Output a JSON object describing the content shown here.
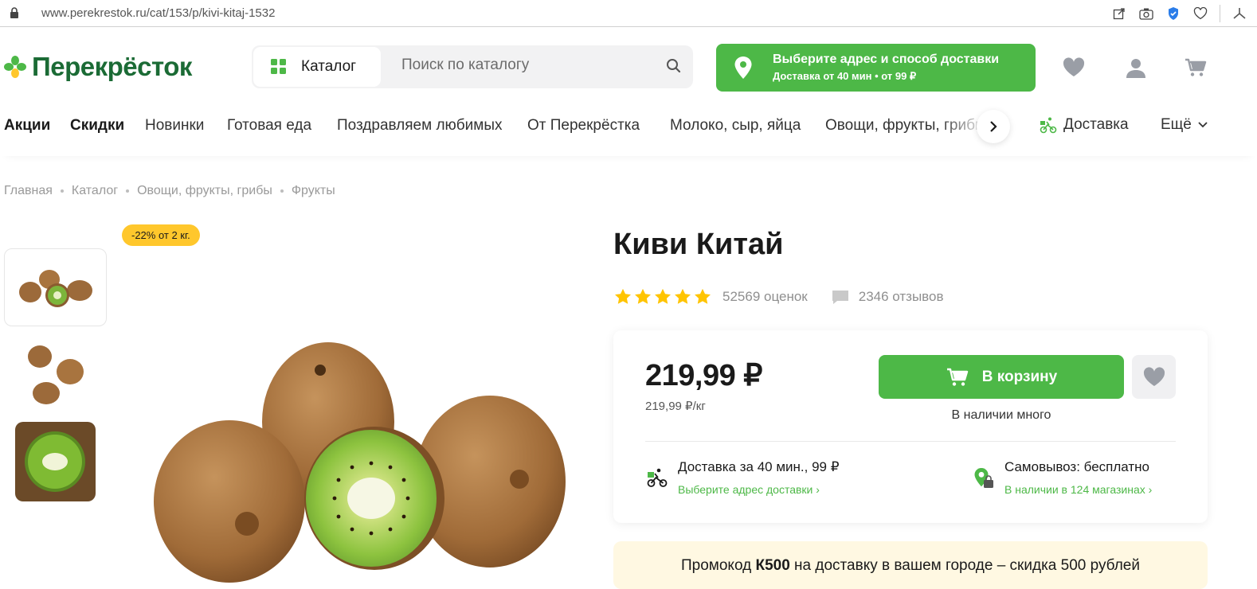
{
  "browser": {
    "url": "www.perekrestok.ru/cat/153/p/kivi-kitaj-1532"
  },
  "header": {
    "logo": "Перекрёсток",
    "catalog_label": "Каталог",
    "search_placeholder": "Поиск по каталогу",
    "delivery_title": "Выберите адрес и способ доставки",
    "delivery_subtitle": "Доставка от 40 мин • от 99 ₽"
  },
  "nav": {
    "items": [
      "Акции",
      "Скидки",
      "Новинки",
      "Готовая еда",
      "Поздравляем любимых",
      "От Перекрёстка",
      "Молоко, сыр, яйца",
      "Овощи, фрукты, грибы"
    ],
    "delivery": "Доставка",
    "more": "Ещё"
  },
  "breadcrumb": [
    "Главная",
    "Каталог",
    "Овощи, фрукты, грибы",
    "Фрукты"
  ],
  "product": {
    "badge": "-22% от 2 кг.",
    "title": "Киви Китай",
    "rating": 5,
    "rating_count": "52569 оценок",
    "reviews": "2346 отзывов",
    "price": "219,99 ₽",
    "unit_price": "219,99 ₽/кг",
    "cart_label": "В корзину",
    "stock": "В наличии много",
    "delivery_title": "Доставка за 40 мин., 99 ₽",
    "delivery_link": "Выберите адрес доставки",
    "pickup_title": "Самовывоз: бесплатно",
    "pickup_link": "В наличии в 124 магазинах"
  },
  "promo": {
    "prefix": "Промокод ",
    "code": "К500",
    "suffix": " на доставку в вашем городе – скидка 500 рублей"
  },
  "colors": {
    "brand_green": "#4db847",
    "logo_green": "#1b6b35",
    "badge_yellow": "#ffc72c",
    "star": "#ffc400"
  }
}
